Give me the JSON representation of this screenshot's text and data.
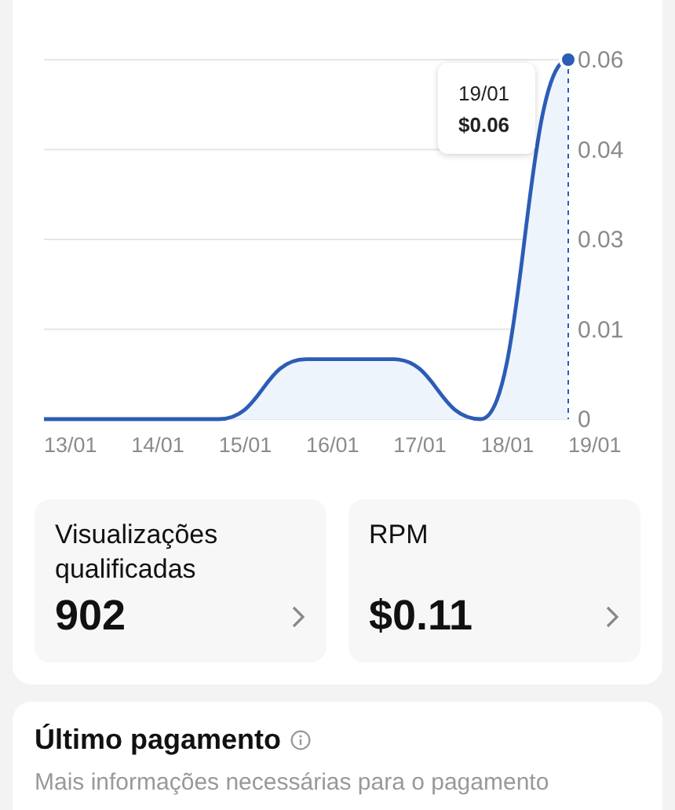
{
  "chart": {
    "chart_data": {
      "type": "area",
      "ylim": [
        0,
        0.06
      ],
      "grid": true,
      "categories": [
        "13/01",
        "14/01",
        "15/01",
        "16/01",
        "17/01",
        "18/01",
        "19/01"
      ],
      "series": [
        {
          "color": "#2c5cb5",
          "values": [
            0,
            0,
            0,
            0.01,
            0.01,
            0,
            0.06
          ]
        }
      ],
      "yticks": [
        {
          "value": 0.06,
          "label": "0.06"
        },
        {
          "value": 0.045,
          "label": "0.04"
        },
        {
          "value": 0.03,
          "label": "0.03"
        },
        {
          "value": 0.015,
          "label": "0.01"
        },
        {
          "value": 0,
          "label": "0"
        }
      ]
    },
    "tooltip": {
      "date": "19/01",
      "value": "$0.06"
    }
  },
  "stats": [
    {
      "label": "Visualizações qualificadas",
      "value": "902"
    },
    {
      "label": "RPM",
      "value": "$0.11"
    }
  ],
  "payment": {
    "title": "Último pagamento",
    "message": "Mais informações necessárias para o pagamento"
  }
}
